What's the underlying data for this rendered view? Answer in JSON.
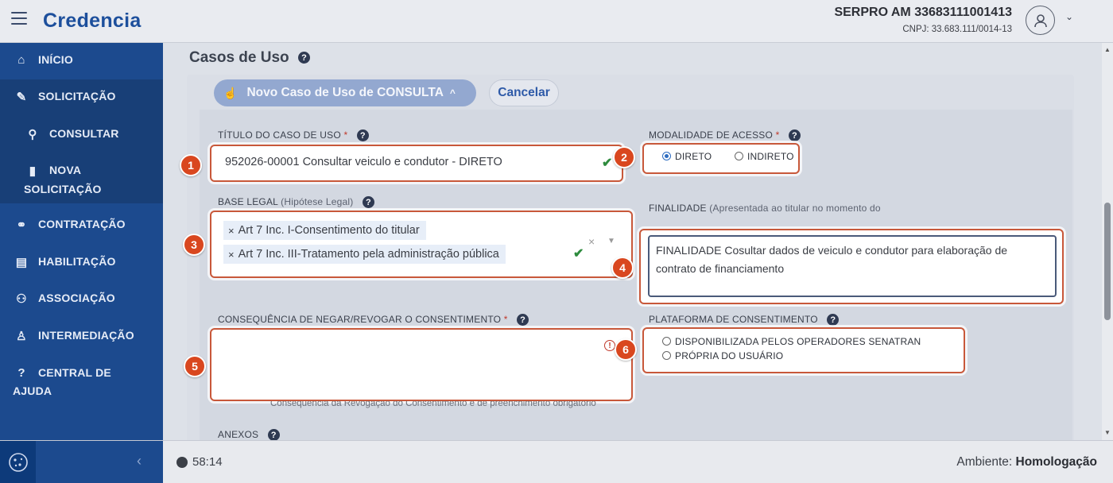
{
  "header": {
    "logo": "Credencia",
    "org_name": "SERPRO AM 33683111001413",
    "org_cnpj": "CNPJ: 33.683.111/0014-13"
  },
  "sidebar": {
    "items": [
      {
        "label": "INÍCIO",
        "icon": "home-icon"
      },
      {
        "label": "SOLICITAÇÃO",
        "icon": "edit-document-icon"
      },
      {
        "label": "CONSULTAR",
        "icon": "search-icon"
      },
      {
        "label": "NOVA SOLICITAÇÃO",
        "line1": "NOVA",
        "line2": "SOLICITAÇÃO",
        "icon": "file-icon"
      },
      {
        "label": "CONTRATAÇÃO",
        "icon": "handshake-icon"
      },
      {
        "label": "HABILITAÇÃO",
        "icon": "id-card-icon"
      },
      {
        "label": "ASSOCIAÇÃO",
        "icon": "users-icon"
      },
      {
        "label": "INTERMEDIAÇÃO",
        "icon": "user-tie-icon"
      },
      {
        "label": "CENTRAL DE AJUDA",
        "line1": "CENTRAL DE",
        "line2": "AJUDA",
        "icon": "question-circle-icon"
      }
    ]
  },
  "main": {
    "title": "Casos de Uso",
    "new_button": "Novo Caso de Uso de CONSULTA",
    "cancel_button": "Cancelar",
    "titulo": {
      "label": "TÍTULO DO CASO DE USO",
      "required": "*",
      "value": "952026-00001 Consultar veiculo e condutor - DIRETO"
    },
    "modalidade": {
      "label": "MODALIDADE DE ACESSO",
      "required": "*",
      "options": [
        "DIRETO",
        "INDIRETO"
      ],
      "selected": "DIRETO"
    },
    "base_legal": {
      "label": "BASE LEGAL",
      "label_sub": "(Hipótese Legal)",
      "tags": [
        "Art 7 Inc. I-Consentimento do titular",
        "Art 7 Inc. III-Tratamento pela administração pública"
      ]
    },
    "finalidade": {
      "label": "FINALIDADE",
      "label_sub": "(Apresentada ao titular no momento do consentimento/conhecimento)",
      "value_line1": "FINALIDADE Cosultar dados de veiculo e condutor para elaboração de",
      "value_line2": "contrato de financiamento"
    },
    "consequencia": {
      "label": "CONSEQUÊNCIA DE NEGAR/REVOGAR O CONSENTIMENTO",
      "required": "*",
      "value": "",
      "hint": "Consequência da Revogação do Consentimento é de preenchimento obrigatório"
    },
    "plataforma": {
      "label": "PLATAFORMA DE CONSENTIMENTO",
      "options": [
        "DISPONIBILIZADA PELOS OPERADORES SENATRAN",
        "PRÓPRIA DO USUÁRIO"
      ]
    },
    "anexos": {
      "label": "ANEXOS"
    }
  },
  "annotations": [
    "1",
    "2",
    "3",
    "4",
    "5",
    "6"
  ],
  "footer": {
    "timer": "58:14",
    "env_label": "Ambiente:",
    "env_value": "Homologação"
  },
  "colors": {
    "brand": "#1d4f9c",
    "sidebar": "#1c4a8e",
    "highlight": "#d9471f"
  }
}
